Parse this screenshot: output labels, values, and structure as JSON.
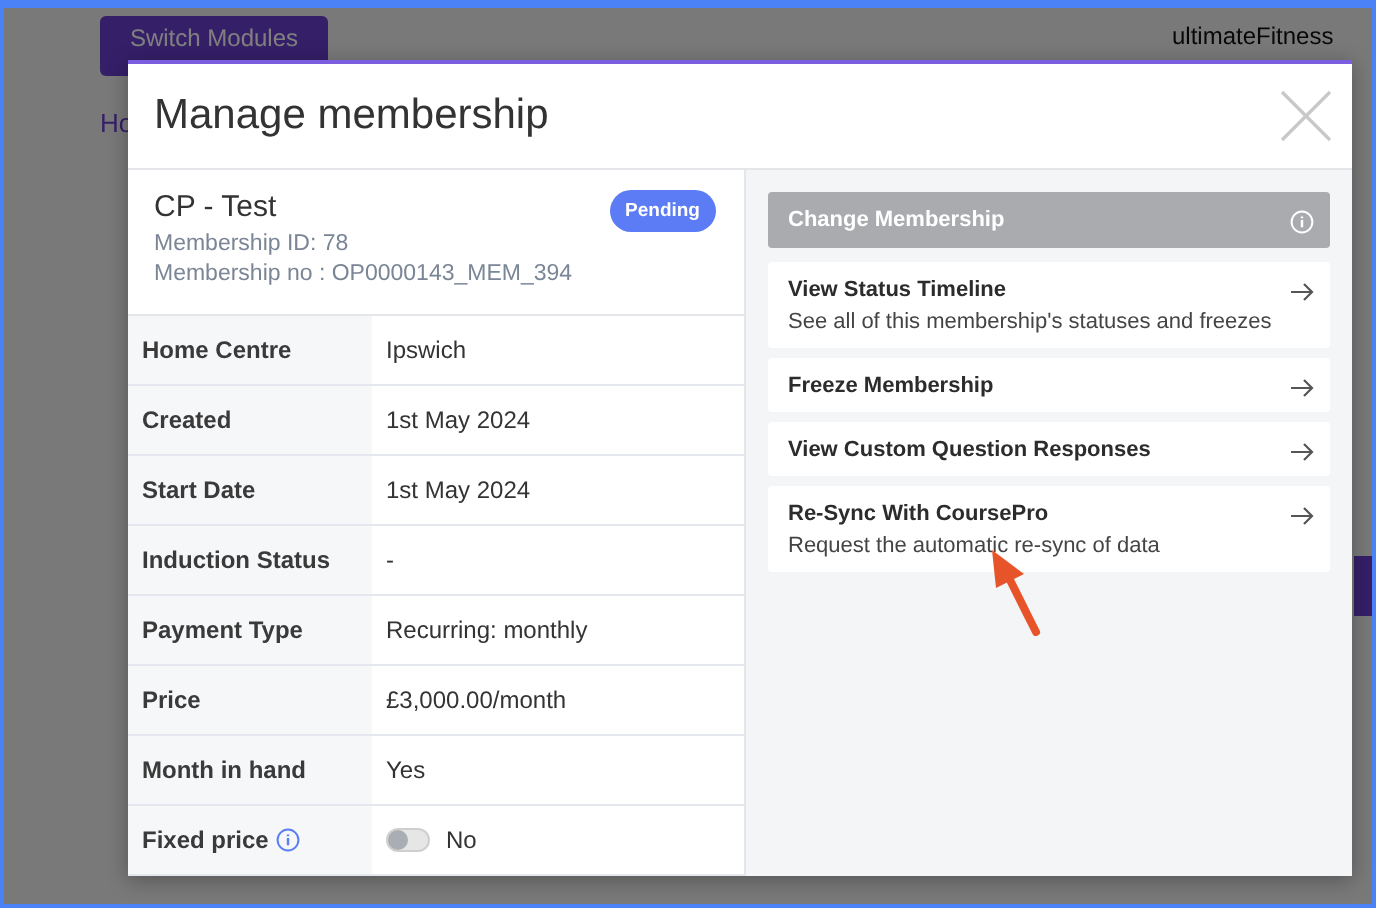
{
  "background_page": {
    "switch_button": "Switch Modules",
    "breadcrumb": "Ho",
    "account": "ultimateFitness"
  },
  "modal": {
    "title": "Manage membership",
    "membership": {
      "name": "CP - Test",
      "id_line": "Membership ID: 78",
      "number_line": "Membership no : OP0000143_MEM_394",
      "status": "Pending"
    },
    "details": [
      {
        "kind": "text",
        "label": "Home Centre",
        "value": "Ipswich",
        "info": false
      },
      {
        "kind": "text",
        "label": "Created",
        "value": "1st May 2024",
        "info": false
      },
      {
        "kind": "text",
        "label": "Start Date",
        "value": "1st May 2024",
        "info": false
      },
      {
        "kind": "text",
        "label": "Induction Status",
        "value": "-",
        "info": false
      },
      {
        "kind": "text",
        "label": "Payment Type",
        "value": "Recurring: monthly",
        "info": false
      },
      {
        "kind": "text",
        "label": "Price",
        "value": "£3,000.00/month",
        "info": false
      },
      {
        "kind": "text",
        "label": "Month in hand",
        "value": "Yes",
        "info": false
      },
      {
        "kind": "toggle",
        "label": "Fixed price",
        "value": "No",
        "info": true,
        "on": false
      }
    ],
    "actions": [
      {
        "title": "Change Membership",
        "disabled": true
      },
      {
        "title": "View Status Timeline",
        "description": "See all of this membership's statuses and freezes",
        "disabled": false
      },
      {
        "title": "Freeze Membership",
        "disabled": false
      },
      {
        "title": "View Custom Question Responses",
        "disabled": false
      },
      {
        "title": "Re-Sync With CoursePro",
        "description": "Request the automatic re-sync of data",
        "disabled": false
      }
    ]
  }
}
